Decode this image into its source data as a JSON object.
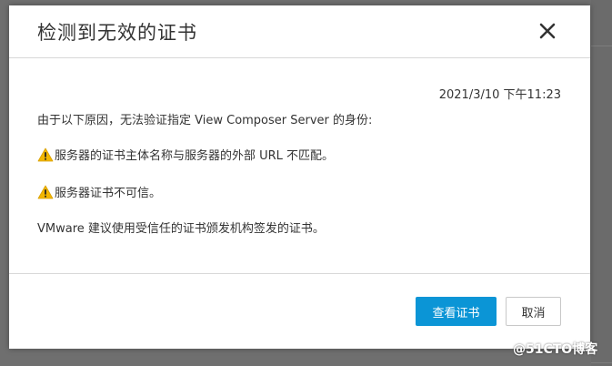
{
  "dialog": {
    "title": "检测到无效的证书",
    "timestamp": "2021/3/10 下午11:23",
    "intro": "由于以下原因，无法验证指定 View Composer Server 的身份:",
    "warnings": [
      "服务器的证书主体名称与服务器的外部 URL 不匹配。",
      "服务器证书不可信。"
    ],
    "recommendation": "VMware 建议使用受信任的证书颁发机构签发的证书。",
    "buttons": {
      "view_certificate": "查看证书",
      "cancel": "取消"
    }
  },
  "watermark": "@51CTO博客",
  "colors": {
    "primary": "#0b95d6",
    "warning": "#f2b600",
    "backdrop": "#6f6f6f"
  }
}
